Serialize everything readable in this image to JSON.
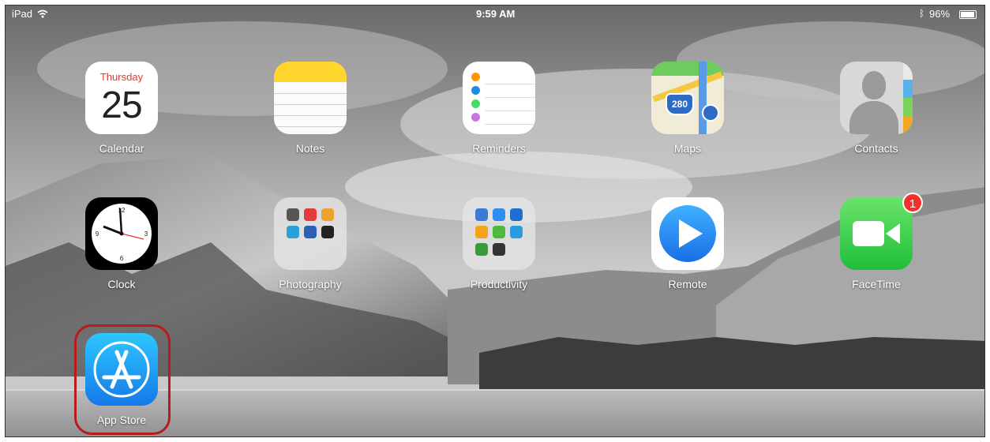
{
  "status_bar": {
    "device": "iPad",
    "time": "9:59 AM",
    "battery": "96%"
  },
  "apps": {
    "calendar": {
      "label": "Calendar",
      "day": "Thursday",
      "date": "25"
    },
    "notes": {
      "label": "Notes"
    },
    "reminders": {
      "label": "Reminders"
    },
    "maps": {
      "label": "Maps",
      "route": "280"
    },
    "contacts": {
      "label": "Contacts"
    },
    "clock": {
      "label": "Clock"
    },
    "photography": {
      "label": "Photography"
    },
    "productivity": {
      "label": "Productivity"
    },
    "remote": {
      "label": "Remote"
    },
    "facetime": {
      "label": "FaceTime",
      "badge": "1"
    },
    "app_store": {
      "label": "App Store"
    }
  },
  "icons": {
    "wifi": "wifi-icon",
    "bluetooth": "bluetooth-icon",
    "battery": "battery-icon",
    "calendar": "calendar-icon",
    "notes": "notes-icon",
    "reminders": "reminders-icon",
    "maps": "maps-icon",
    "contacts": "contacts-icon",
    "clock": "clock-icon",
    "remote": "play-icon",
    "facetime": "video-camera-icon",
    "app_store": "app-store-icon"
  },
  "colors": {
    "highlight": "#b71c1c",
    "badge": "#f2322a",
    "calendar_red": "#e8372b",
    "notes_yellow": "#ffd52e",
    "facetime_green": "#4cd964",
    "app_store_blue": "#1a8cf0"
  }
}
